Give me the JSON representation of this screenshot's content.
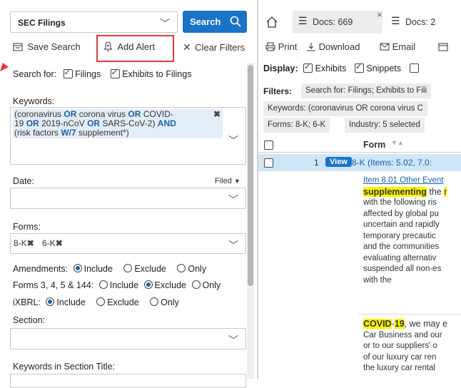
{
  "search": {
    "collection": "SEC Filings",
    "button_label": "Search"
  },
  "toolbar": {
    "save_search": "Save Search",
    "add_alert": "Add Alert",
    "clear_filters": "Clear Filters"
  },
  "search_for": {
    "label": "Search for:",
    "filings": "Filings",
    "exhibits": "Exhibits to Filings"
  },
  "keywords": {
    "label": "Keywords:",
    "line1_a": "(coronavirus ",
    "or1": "OR",
    "line1_b": " corona virus ",
    "or2": "OR",
    "line1_c": " COVID-",
    "line2_a": "19 ",
    "or3": "OR",
    "line2_b": " 2019-nCoV ",
    "or4": "OR",
    "line2_c": " SARS-CoV-2) ",
    "and1": "AND",
    "line3_a": "(risk factors ",
    "w7": "W/7",
    "line3_b": " supplement*)"
  },
  "date": {
    "label": "Date:",
    "filed": "Filed"
  },
  "forms": {
    "label": "Forms:",
    "tags": [
      "8-K",
      "6-K"
    ]
  },
  "amendments": {
    "label": "Amendments:",
    "include": "Include",
    "exclude": "Exclude",
    "only": "Only"
  },
  "forms344": {
    "label": "Forms 3, 4, 5 & 144:",
    "include": "Include",
    "exclude": "Exclude",
    "only": "Only"
  },
  "ixbrl": {
    "label": "iXBRL:",
    "include": "Include",
    "exclude": "Exclude",
    "only": "Only"
  },
  "section": {
    "label": "Section:"
  },
  "kw_section_title": {
    "label": "Keywords in Section Title:"
  },
  "tabs": {
    "tab1": "Docs: 669",
    "tab2": "Docs: 2"
  },
  "actions": {
    "print": "Print",
    "download": "Download",
    "email": "Email"
  },
  "display": {
    "label": "Display:",
    "exhibits": "Exhibits",
    "snippets": "Snippets"
  },
  "filters": {
    "label": "Filters:",
    "search_for": "Search for: Filings; Exhibits to Fili",
    "keywords": "Keywords: (coronavirus OR corona virus C",
    "forms": "Forms: 8-K; 6-K",
    "industry": "Industry: 5 selected"
  },
  "table": {
    "col_form": "Form",
    "row_num": "1",
    "view": "View",
    "row_form": "8-K (Items: 5.02, 7.0:"
  },
  "snippet1": {
    "link": "Item 8.01 Other Event",
    "l1_hl": "supplementing",
    "l1_rest": " the ",
    "l1_hl2": "r",
    "lines": [
      "with the following ris",
      "affected by global pu",
      "uncertain and rapidly",
      "temporary precautic",
      "and the communities",
      "evaluating alternativ",
      "suspended all non-es",
      "with the"
    ]
  },
  "snippet2": {
    "hl1": "COVID",
    "dash": "-",
    "hl2": "19",
    "rest": ", we may e",
    "lines": [
      "Car Business and our",
      "or to our suppliers' o",
      "of our luxury car ren",
      "the luxury car rental"
    ]
  },
  "colors": {
    "accent": "#1a73c7",
    "highlight": "#fff200",
    "alert_box": "#e53935",
    "row_select": "#cfe6f7"
  }
}
